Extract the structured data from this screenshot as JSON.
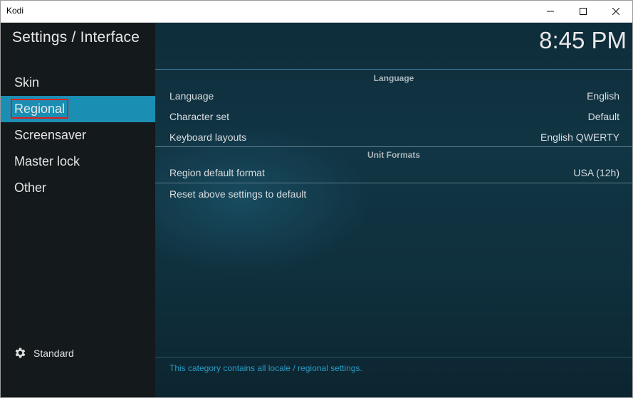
{
  "window": {
    "title": "Kodi",
    "controls": [
      "minimize",
      "maximize",
      "close"
    ]
  },
  "sidebar": {
    "title": "Settings / Interface",
    "items": [
      {
        "label": "Skin",
        "active": false
      },
      {
        "label": "Regional",
        "active": true
      },
      {
        "label": "Screensaver",
        "active": false
      },
      {
        "label": "Master lock",
        "active": false
      },
      {
        "label": "Other",
        "active": false
      }
    ],
    "level": {
      "icon": "gear-icon",
      "label": "Standard"
    }
  },
  "main": {
    "clock": "8:45 PM",
    "sections": [
      {
        "title": "Language",
        "rows": [
          {
            "label": "Language",
            "value": "English"
          },
          {
            "label": "Character set",
            "value": "Default"
          },
          {
            "label": "Keyboard layouts",
            "value": "English QWERTY"
          }
        ]
      },
      {
        "title": "Unit Formats",
        "rows": [
          {
            "label": "Region default format",
            "value": "USA (12h)"
          }
        ]
      }
    ],
    "reset_label": "Reset above settings to default",
    "description": "This category contains all locale / regional settings."
  },
  "colors": {
    "accent": "#1b8eb3",
    "highlight_border": "#e02020",
    "footer_text": "#2a9cc5"
  }
}
